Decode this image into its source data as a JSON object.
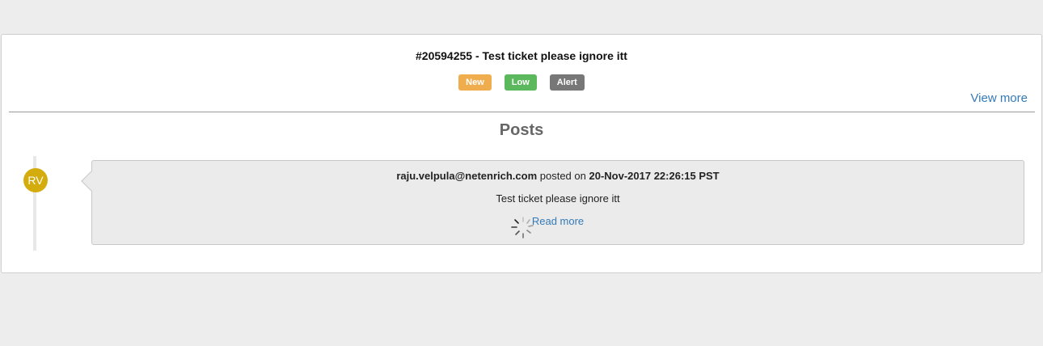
{
  "ticket": {
    "title": "#20594255 -  Test ticket please ignore itt",
    "badges": {
      "status": "New",
      "priority": "Low",
      "type": "Alert"
    },
    "view_more_label": "View more"
  },
  "posts": {
    "heading": "Posts",
    "items": [
      {
        "avatar_initials": "RV",
        "author": "raju.velpula@netenrich.com",
        "posted_on_text": "posted on",
        "timestamp": "20-Nov-2017 22:26:15 PST",
        "body": "Test ticket please ignore itt",
        "read_more_label": "Read more"
      }
    ]
  },
  "colors": {
    "new_badge": "#f0ad4e",
    "low_badge": "#5cb85c",
    "alert_badge": "#777777",
    "avatar": "#d4ac0d",
    "link": "#337ab7"
  },
  "icons": {
    "loading": "spinner-icon"
  }
}
